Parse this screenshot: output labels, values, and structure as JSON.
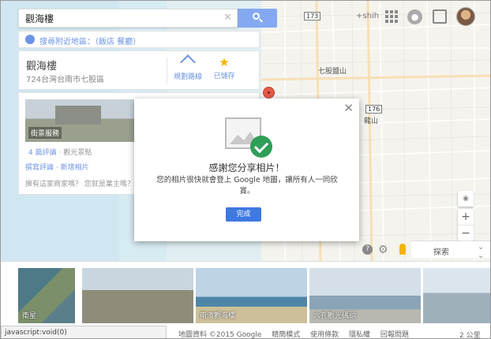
{
  "search": {
    "query": "觀海樓"
  },
  "nearby_prompt": "搜尋附近地區：（飯店 餐廳）",
  "place": {
    "name": "觀海樓",
    "address": "724台灣台南市七股區",
    "route_label": "規劃路線",
    "save_label": "已儲存"
  },
  "details": {
    "photo_tag": "街景服務",
    "reviews": "4 篇評論",
    "category": "· 觀光景點",
    "write_review": "撰寫評論 · 新增相片",
    "owner_prompt": "擁有這家商家嗎？ 您就是業主嗎？"
  },
  "account": {
    "plus_label": "+shih"
  },
  "map_labels": {
    "town": "七股鹽山",
    "area": "龍山",
    "road1": "173",
    "road2": "176",
    "road3": "173"
  },
  "modal": {
    "title": "感謝您分享相片！",
    "message": "您的相片很快就會登上 Google 地圖，讓所有人一同欣賞。",
    "done_label": "完成"
  },
  "explore": {
    "label": "探索"
  },
  "thumbnails": [
    {
      "caption": "衛星"
    },
    {
      "caption": ""
    },
    {
      "caption": "南濱觀海樓"
    },
    {
      "caption": "六孔觀光碼頭"
    },
    {
      "caption": ""
    }
  ],
  "status_bar": "javascript:void(0)",
  "footer": {
    "copyright": "地圖資料 ©2015 Google",
    "links": [
      "精簡模式",
      "使用條款",
      "隱私權",
      "回報問題"
    ],
    "scale": "2 公里"
  },
  "colors": {
    "accent": "#3e78e2",
    "check": "#2f9e57",
    "star": "#f5b400",
    "link": "#6c94e6"
  }
}
